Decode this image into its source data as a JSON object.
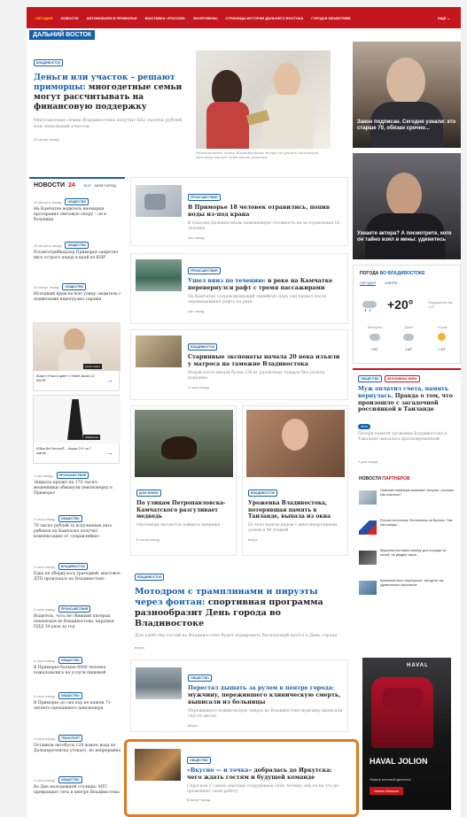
{
  "nav": {
    "items": [
      "Сегодня",
      "Новости",
      "Автомобили в Приморье",
      "Выставка «Россия»",
      "Вооружены",
      "Страницы истории Дальнего Востока",
      "Город в объективе"
    ],
    "more": "Еще ⌄"
  },
  "region": "Дальний Восток",
  "hero": {
    "tag": "Владивосток",
    "title_blue": "Деньги или участок – решают приморцы:",
    "title_rest": " многодетные семьи могут рассчитывать на финансовую поддержку",
    "lead": "Многодетные семьи Владивостока получат 602 тысячи рублей или земельный участок",
    "time": "35 минут назад",
    "caption": "Многодетные семьи Владивостока могут получить денежную выплату взамен земельного участка."
  },
  "side_promos": [
    {
      "text": "Закон подписан. Сегодня узнали: кто старше 70, обязан срочно..."
    },
    {
      "text": "Узнаете актера? А посмотрите, кого он тайно взял в жены: удивитесь"
    }
  ],
  "news": {
    "title": "Новости",
    "count": "24",
    "tabs": [
      "Все",
      "Мой город"
    ],
    "items": [
      {
        "time": "24 минуты назад",
        "tag": "Общество",
        "text": "На Камчатке водитель иномарки протаранил световую опору – он в больнице"
      },
      {
        "time": "24 минуты назад",
        "tag": "Общество",
        "text": "Росавтотрибнадзор Приморья запретил ввоз острого перца в край из КНР"
      },
      {
        "time": "30 минут назад",
        "tag": "Общество",
        "text": "Исходный крем на всю улицу: водитель с подвесками перегрузил гаражи"
      },
      {
        "time": "1 час назад",
        "tag": "Происшествия",
        "text": "Закрыла кредит на 170 тысяч: мошенники обманули пенсионерку в Приморье"
      },
      {
        "time": "2 часа назад",
        "tag": "Общество",
        "text": "70 тысяч рублей за вспученные авто ребенок на Камчатке получит компенсацию от «управляйки»"
      },
      {
        "time": "3 часа назад",
        "tag": "Владивосток",
        "text": "Едва не обернулось трагедией: массовое ДТП произошло во Владивостоке"
      },
      {
        "time": "3 часа назад",
        "tag": "Происшествия",
        "text": "Водитель, чуть не сбивший пятерых пешеходов во Владивостоке, нарушая ПДД 34 раза за год"
      },
      {
        "time": "3 часа назад",
        "tag": "Общество",
        "text": "В Приморье больше 6000 человек пожаловались на услуги пищевой"
      },
      {
        "time": "4 часа назад",
        "tag": "Общество",
        "text": "В Приморье до сих пор не нашли 71-летнего пропавшего пенсионера"
      },
      {
        "time": "4 часа назад",
        "tag": "Транспорт",
        "text": "Оставили автобусы 129 домов: вода из Дальнереченска утекает, но непрерывно"
      },
      {
        "time": "4 часа назад",
        "tag": "Общество",
        "text": "Во Дне молодежной столицы: МТС превращает сеть в центре Владивостока"
      }
    ],
    "ads": [
      {
        "label": "Gloria Jeans",
        "text": "Жакет «Настя цвет» • Street studio 12 600 ₽"
      },
      {
        "label": "Wildberries",
        "text": "Юбка Bel Norton® – Акция 2+1 за 7 шагов"
      }
    ]
  },
  "articles": [
    {
      "tag": "Происшествия",
      "title": "В Приморье 18 человек отравились, попив воды из-под крана",
      "lead": "В Спасске-Дальнем вновь повышенную готовность из-за отравления 18 человек",
      "time": "час назад"
    },
    {
      "tag": "Происшествия",
      "title_blue": "Ушел вниз по течению:",
      "title_rest": " в реке на Камчатке перевернулся рафт с тремя пассажирами",
      "lead": "На Камчатке сопровождающий семейную пару гид провел после опрокидывания рафта на реке",
      "time": "час назад"
    },
    {
      "tag": "Владивосток",
      "title": "Старинные экспонаты начала 20 века изъяли у матроса на таможне Владивостока",
      "lead": "Моряк хотел ввезти более 230 кг различных товаров без уплаты пошлины",
      "time": "3 часа назад"
    }
  ],
  "two_col": [
    {
      "tag": "Дом земли",
      "title": "По улицам Петропавловска-Камчатского разгуливает медведь",
      "lead": "Охотоведы пытаются поймать хищника",
      "time": "6 часов назад"
    },
    {
      "tag": "Владивосток",
      "title": "Уроженка Владивостока, потерявшая память в Таиланде, выпала из окна",
      "lead": "Ее тело нашли рядом с многоквартирным домом в 40 этажей",
      "time": "вчера"
    }
  ],
  "feature": {
    "tag": "Владивосток",
    "title_blue": "Мотодром с трамплинами и пируэты через фонтан:",
    "title_rest": " спортивная программа разнообразит День города во Владивостоке",
    "lead": "Для удобства гостей во Владивостоке будет курировать бесплатный шаттл в День города",
    "time": "вчера"
  },
  "bottom_articles": [
    {
      "tag": "Общество",
      "title_blue": "Перестал дышать за рулем в центре города:",
      "title_rest": " мужчину, пережившего клиническую смерть, выписали из больницы",
      "lead": "Пережившего клиническую смерть во Владивостоке мужчину выписали спустя месяц",
      "time": "вчера"
    },
    {
      "tag": "Общество",
      "title_blue": "«Вкусно — и точка»",
      "title_rest": " добралась до Иркутска: чего ждать гостям и будущей команде",
      "lead": "Спросили у самых опытных сотрудников сети, почему они не на что не променяют свою работу",
      "time": "6 минут назад"
    }
  ],
  "weather": {
    "title_prefix": "Погода",
    "title_city": "во Владивостоке",
    "tabs": [
      "Сегодня",
      "Завтра"
    ],
    "now_temp": "+20°",
    "now_desc": "Ощущается как +21°",
    "periods": [
      {
        "label": "Вечером",
        "temp": "+20°"
      },
      {
        "label": "Днем",
        "temp": "+18°"
      },
      {
        "label": "Утром",
        "temp": "+19°"
      }
    ]
  },
  "right_article": {
    "tags": [
      "Общество",
      "Экономика мира"
    ],
    "title_blue": "Муж оплатил счета, память вернулась.",
    "title_rest": " Правда о том, что произошло с загадочной россиянкой в Таиланде",
    "badge": "Фото",
    "lead": "Потеря памяти уроженки Владивостока в Таиланде оказалась кратковременной",
    "time": "2 дня назад"
  },
  "partners": {
    "title_prefix": "Новости",
    "title_accent": "партнеров",
    "items": [
      {
        "text": "Опасная инфекция вызывает инсульт: россиян как спастись?"
      },
      {
        "text": "Россия источника: Филиппины за Бритни: Там настоящих"
      },
      {
        "text": "Мужчина поставил камеру для соседки за ночей, не увидел такое..."
      },
      {
        "text": "Крымский мост перекрыли: заходите так удивительно серьезное"
      }
    ]
  },
  "haval_ad": {
    "brand": "HAVAL",
    "model": "HAVAL JOLION",
    "tagline": "Первый ключевой двигатель",
    "cta": "Узнать больше"
  }
}
